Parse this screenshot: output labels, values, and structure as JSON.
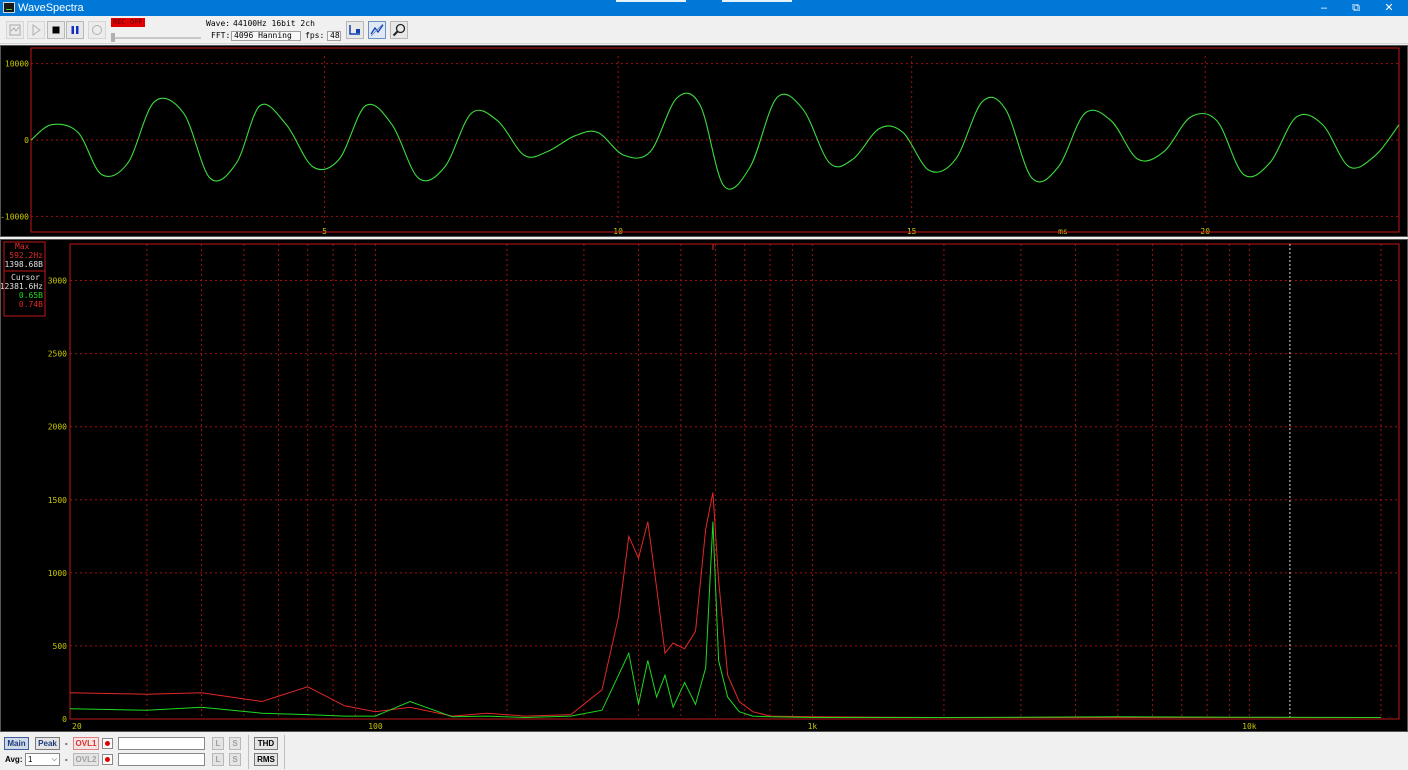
{
  "window": {
    "title": "WaveSpectra",
    "minimize_glyph": "–",
    "restore_glyph": "⧉",
    "close_glyph": "✕"
  },
  "toolbar": {
    "rec_label": "REC OFF",
    "icons": [
      "open-wave-icon",
      "play-icon",
      "stop-icon",
      "pause-icon",
      "record-icon",
      "channel-select-icon",
      "wave-display-icon",
      "zoom-tool-icon"
    ],
    "wave_info_label": "Wave:",
    "wave_info": "44100Hz 16bit 2ch",
    "fft_label": "FFT:",
    "fft_info": "4096 Hanning",
    "fps_label": "fps:",
    "fps_value": "48"
  },
  "wave_chart": {
    "y_ticks": [
      "10000",
      "0",
      "-10000"
    ],
    "x_ticks": [
      "5",
      "10",
      "15",
      "20"
    ],
    "x_unit": "ms",
    "colors": {
      "wave": "#3cdc3c",
      "grid": "#a01010",
      "frame": "#c01818",
      "label": "#c8c800"
    }
  },
  "spectrum": {
    "max_box": {
      "title": "Max",
      "freq": "592.2Hz",
      "value": "1398.68B"
    },
    "cursor_box": {
      "title": "Cursor",
      "freq": "12381.6Hz",
      "left_value": "0.65B",
      "right_value": "0.74B"
    },
    "y_ticks": [
      "3000",
      "2500",
      "2000",
      "1500",
      "1000",
      "500",
      "0"
    ],
    "x_ticks": [
      "20",
      "100",
      "1k",
      "10k"
    ],
    "colors": {
      "left": "#20d820",
      "right": "#e02828",
      "grid": "#a01010",
      "cursor": "#e0e0e0"
    }
  },
  "statusbar": {
    "main_label": "Main",
    "peak_label": "Peak",
    "dash1": "-",
    "ovl1_label": "OVL1",
    "avg_label": "Avg:",
    "avg_value": "1",
    "dash2": "-",
    "ovl2_label": "OVL2",
    "l1": "L",
    "s1": "S",
    "l2": "L",
    "s2": "S",
    "thd_label": "THD",
    "rms_label": "RMS"
  },
  "chart_data": [
    {
      "type": "line",
      "xlabel": "ms",
      "ylabel": "",
      "xlim": [
        0,
        23.3
      ],
      "ylim": [
        -11000,
        11000
      ],
      "x_ticks": [
        5,
        10,
        15,
        20
      ],
      "y_ticks": [
        10000,
        0,
        -10000
      ],
      "grid": true,
      "series": [
        {
          "x": [
            0,
            0.35,
            0.8,
            1.2,
            1.65,
            2.1,
            2.6,
            3.05,
            3.5,
            3.9,
            4.35,
            4.8,
            5.25,
            5.7,
            6.15,
            6.6,
            7.05,
            7.5,
            7.95,
            8.4,
            8.8,
            9.25,
            9.65,
            10.1,
            10.55,
            11.0,
            11.4,
            11.8,
            12.25,
            12.7,
            13.15,
            13.6,
            14.0,
            14.45,
            14.85,
            15.3,
            15.75,
            16.2,
            16.6,
            17.05,
            17.5,
            17.95,
            18.4,
            18.85,
            19.3,
            19.75,
            20.2,
            20.65,
            21.1,
            21.55,
            22.0,
            22.45,
            22.9,
            23.3
          ],
          "y": [
            0,
            2000,
            1000,
            -4500,
            -3000,
            5000,
            3500,
            -5000,
            -3000,
            4500,
            2000,
            -3500,
            -2500,
            4500,
            2000,
            -5000,
            -3500,
            3500,
            2500,
            -2000,
            -1500,
            500,
            1000,
            -2000,
            -1500,
            5500,
            4500,
            -6000,
            -3500,
            5500,
            4000,
            -3000,
            -2500,
            1500,
            1000,
            -4000,
            -2500,
            5000,
            4000,
            -5000,
            -3500,
            3500,
            2500,
            -2500,
            -1500,
            3000,
            2500,
            -4500,
            -3000,
            3000,
            2000,
            -3500,
            -2000,
            2000
          ]
        }
      ]
    },
    {
      "type": "line",
      "xlabel": "",
      "ylabel": "",
      "x_scale": "log",
      "xlim": [
        20,
        22000
      ],
      "ylim": [
        0,
        3250
      ],
      "x_ticks": [
        "20",
        "100",
        "1k",
        "10k"
      ],
      "y_ticks": [
        3000,
        2500,
        2000,
        1500,
        1000,
        500,
        0
      ],
      "grid": true,
      "cursor_x": 12381.6,
      "series": [
        {
          "channel": "right",
          "x": [
            20,
            30,
            40,
            55,
            70,
            85,
            100,
            120,
            150,
            180,
            220,
            280,
            330,
            360,
            380,
            400,
            420,
            440,
            460,
            480,
            510,
            540,
            570,
            592,
            610,
            640,
            680,
            730,
            800,
            1000,
            2000,
            5000,
            10000,
            20000
          ],
          "y": [
            180,
            170,
            180,
            120,
            220,
            90,
            50,
            80,
            20,
            40,
            20,
            30,
            200,
            700,
            1250,
            1100,
            1350,
            900,
            450,
            520,
            480,
            600,
            1300,
            1550,
            950,
            300,
            120,
            50,
            20,
            15,
            10,
            10,
            10,
            10
          ]
        },
        {
          "channel": "left",
          "x": [
            20,
            30,
            40,
            55,
            70,
            85,
            100,
            120,
            150,
            180,
            220,
            280,
            330,
            360,
            380,
            400,
            420,
            440,
            460,
            480,
            510,
            540,
            570,
            592,
            610,
            640,
            680,
            730,
            800,
            1000,
            2000,
            5000,
            10000,
            20000
          ],
          "y": [
            70,
            60,
            80,
            40,
            30,
            20,
            20,
            120,
            15,
            20,
            10,
            20,
            60,
            300,
            450,
            100,
            400,
            150,
            300,
            80,
            250,
            100,
            350,
            1350,
            400,
            150,
            50,
            20,
            15,
            10,
            10,
            15,
            12,
            10
          ]
        }
      ]
    }
  ]
}
